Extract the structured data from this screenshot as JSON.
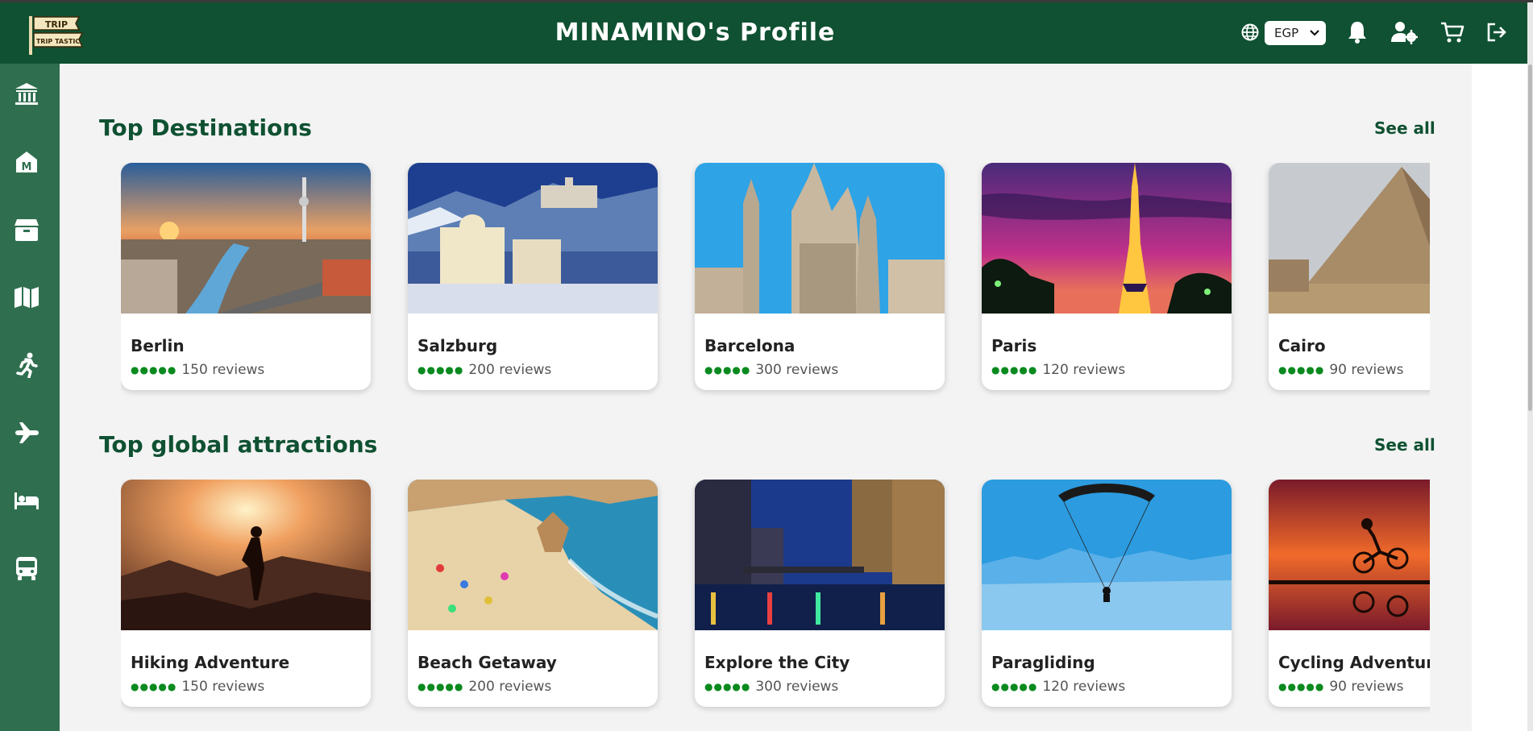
{
  "header": {
    "logo_text_top": "TRIP",
    "logo_text_bottom": "TRIP TASTIC",
    "title": "MINAMINO's Profile",
    "currency": "EGP",
    "icons": [
      "globe-icon",
      "bell-icon",
      "user-settings-icon",
      "cart-icon",
      "logout-icon"
    ]
  },
  "sidebar": {
    "items": [
      {
        "icon": "museum-icon"
      },
      {
        "icon": "historical-place-icon"
      },
      {
        "icon": "products-icon"
      },
      {
        "icon": "map-icon"
      },
      {
        "icon": "activity-icon"
      },
      {
        "icon": "flight-icon"
      },
      {
        "icon": "hotel-icon"
      },
      {
        "icon": "bus-icon"
      }
    ]
  },
  "sections": [
    {
      "title": "Top Destinations",
      "see_all": "See all",
      "cards": [
        {
          "name": "Berlin",
          "reviews": "150 reviews",
          "rating": 5
        },
        {
          "name": "Salzburg",
          "reviews": "200 reviews",
          "rating": 5
        },
        {
          "name": "Barcelona",
          "reviews": "300 reviews",
          "rating": 5
        },
        {
          "name": "Paris",
          "reviews": "120 reviews",
          "rating": 5
        },
        {
          "name": "Cairo",
          "reviews": "90 reviews",
          "rating": 5
        }
      ]
    },
    {
      "title": "Top global attractions",
      "see_all": "See all",
      "cards": [
        {
          "name": "Hiking Adventure",
          "reviews": "150 reviews",
          "rating": 5
        },
        {
          "name": "Beach Getaway",
          "reviews": "200 reviews",
          "rating": 5
        },
        {
          "name": "Explore the City",
          "reviews": "300 reviews",
          "rating": 5
        },
        {
          "name": "Paragliding",
          "reviews": "120 reviews",
          "rating": 5
        },
        {
          "name": "Cycling Adventure",
          "reviews": "90 reviews",
          "rating": 5
        }
      ]
    }
  ],
  "colors": {
    "brand": "#0f5132",
    "sidebar": "#2f6f4f",
    "rating_dots": "#0a8a1f"
  }
}
